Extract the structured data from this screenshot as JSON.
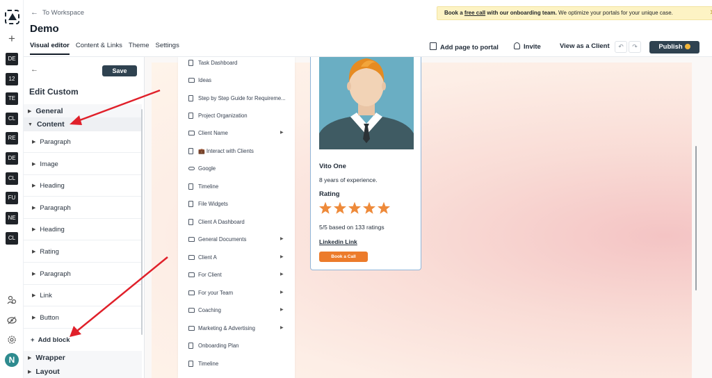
{
  "rail": {
    "workspaces": [
      "DE",
      "12",
      "TE",
      "CL",
      "RE",
      "DE",
      "CL",
      "FU",
      "NE",
      "CL"
    ],
    "avatar_initial": "N"
  },
  "header": {
    "back_link": "To Workspace",
    "title": "Demo",
    "tabs": [
      "Visual editor",
      "Content & Links",
      "Theme",
      "Settings"
    ],
    "banner": {
      "prefix": "Book a ",
      "link": "free call",
      "middle": " with our onboarding team.",
      "suffix": " We optimize your portals for your unique case."
    },
    "actions": {
      "add_page": "Add page to portal",
      "invite": "Invite",
      "view_as_client": "View as a Client",
      "publish": "Publish"
    }
  },
  "editor": {
    "save": "Save",
    "title": "Edit Custom",
    "general": "General",
    "content": "Content",
    "blocks": [
      "Paragraph",
      "Image",
      "Heading",
      "Paragraph",
      "Heading",
      "Rating",
      "Paragraph",
      "Link",
      "Button"
    ],
    "add_block": "Add block",
    "wrapper": "Wrapper",
    "layout": "Layout"
  },
  "nav": {
    "items": [
      {
        "label": "Task Dashboard",
        "icon": "doc-icon"
      },
      {
        "label": "Ideas",
        "icon": "folder-icon"
      },
      {
        "label": "Step by Step Guide for Requireme...",
        "icon": "doc-icon"
      },
      {
        "label": "Project Organization",
        "icon": "doc-icon"
      },
      {
        "label": "Client Name",
        "icon": "folder-icon",
        "expandable": true
      },
      {
        "label": "💼 Interact with Clients",
        "icon": "doc-icon"
      },
      {
        "label": "Google",
        "icon": "link-icon"
      },
      {
        "label": "Timeline",
        "icon": "doc-icon"
      },
      {
        "label": "File Widgets",
        "icon": "doc-icon"
      },
      {
        "label": "Client A Dashboard",
        "icon": "doc-icon"
      },
      {
        "label": "General Documents",
        "icon": "folder-icon",
        "expandable": true
      },
      {
        "label": "Client A",
        "icon": "folder-icon",
        "expandable": true
      },
      {
        "label": "For Client",
        "icon": "folder-icon",
        "expandable": true
      },
      {
        "label": "For your Team",
        "icon": "folder-icon",
        "expandable": true
      },
      {
        "label": "Coaching",
        "icon": "folder-icon",
        "expandable": true
      },
      {
        "label": "Marketing & Advertising",
        "icon": "folder-icon",
        "expandable": true
      },
      {
        "label": "Onboarding Plan",
        "icon": "doc-icon"
      },
      {
        "label": "Timeline",
        "icon": "doc-icon"
      }
    ]
  },
  "profile": {
    "name": "Vito One",
    "experience": "8 years of experience.",
    "rating_label": "Rating",
    "rating_stars": 5,
    "rating_max": 5,
    "ratings_text": "5/5 based on 133 ratings",
    "link": "Linkedin Link",
    "button": "Book a Call"
  },
  "colors": {
    "primary_dark": "#2f4250",
    "banner_bg": "#fdf3c4",
    "accent_orange": "#ec7b2b",
    "star": "#ee8a3a",
    "annotation_arrow": "#e0202a"
  }
}
